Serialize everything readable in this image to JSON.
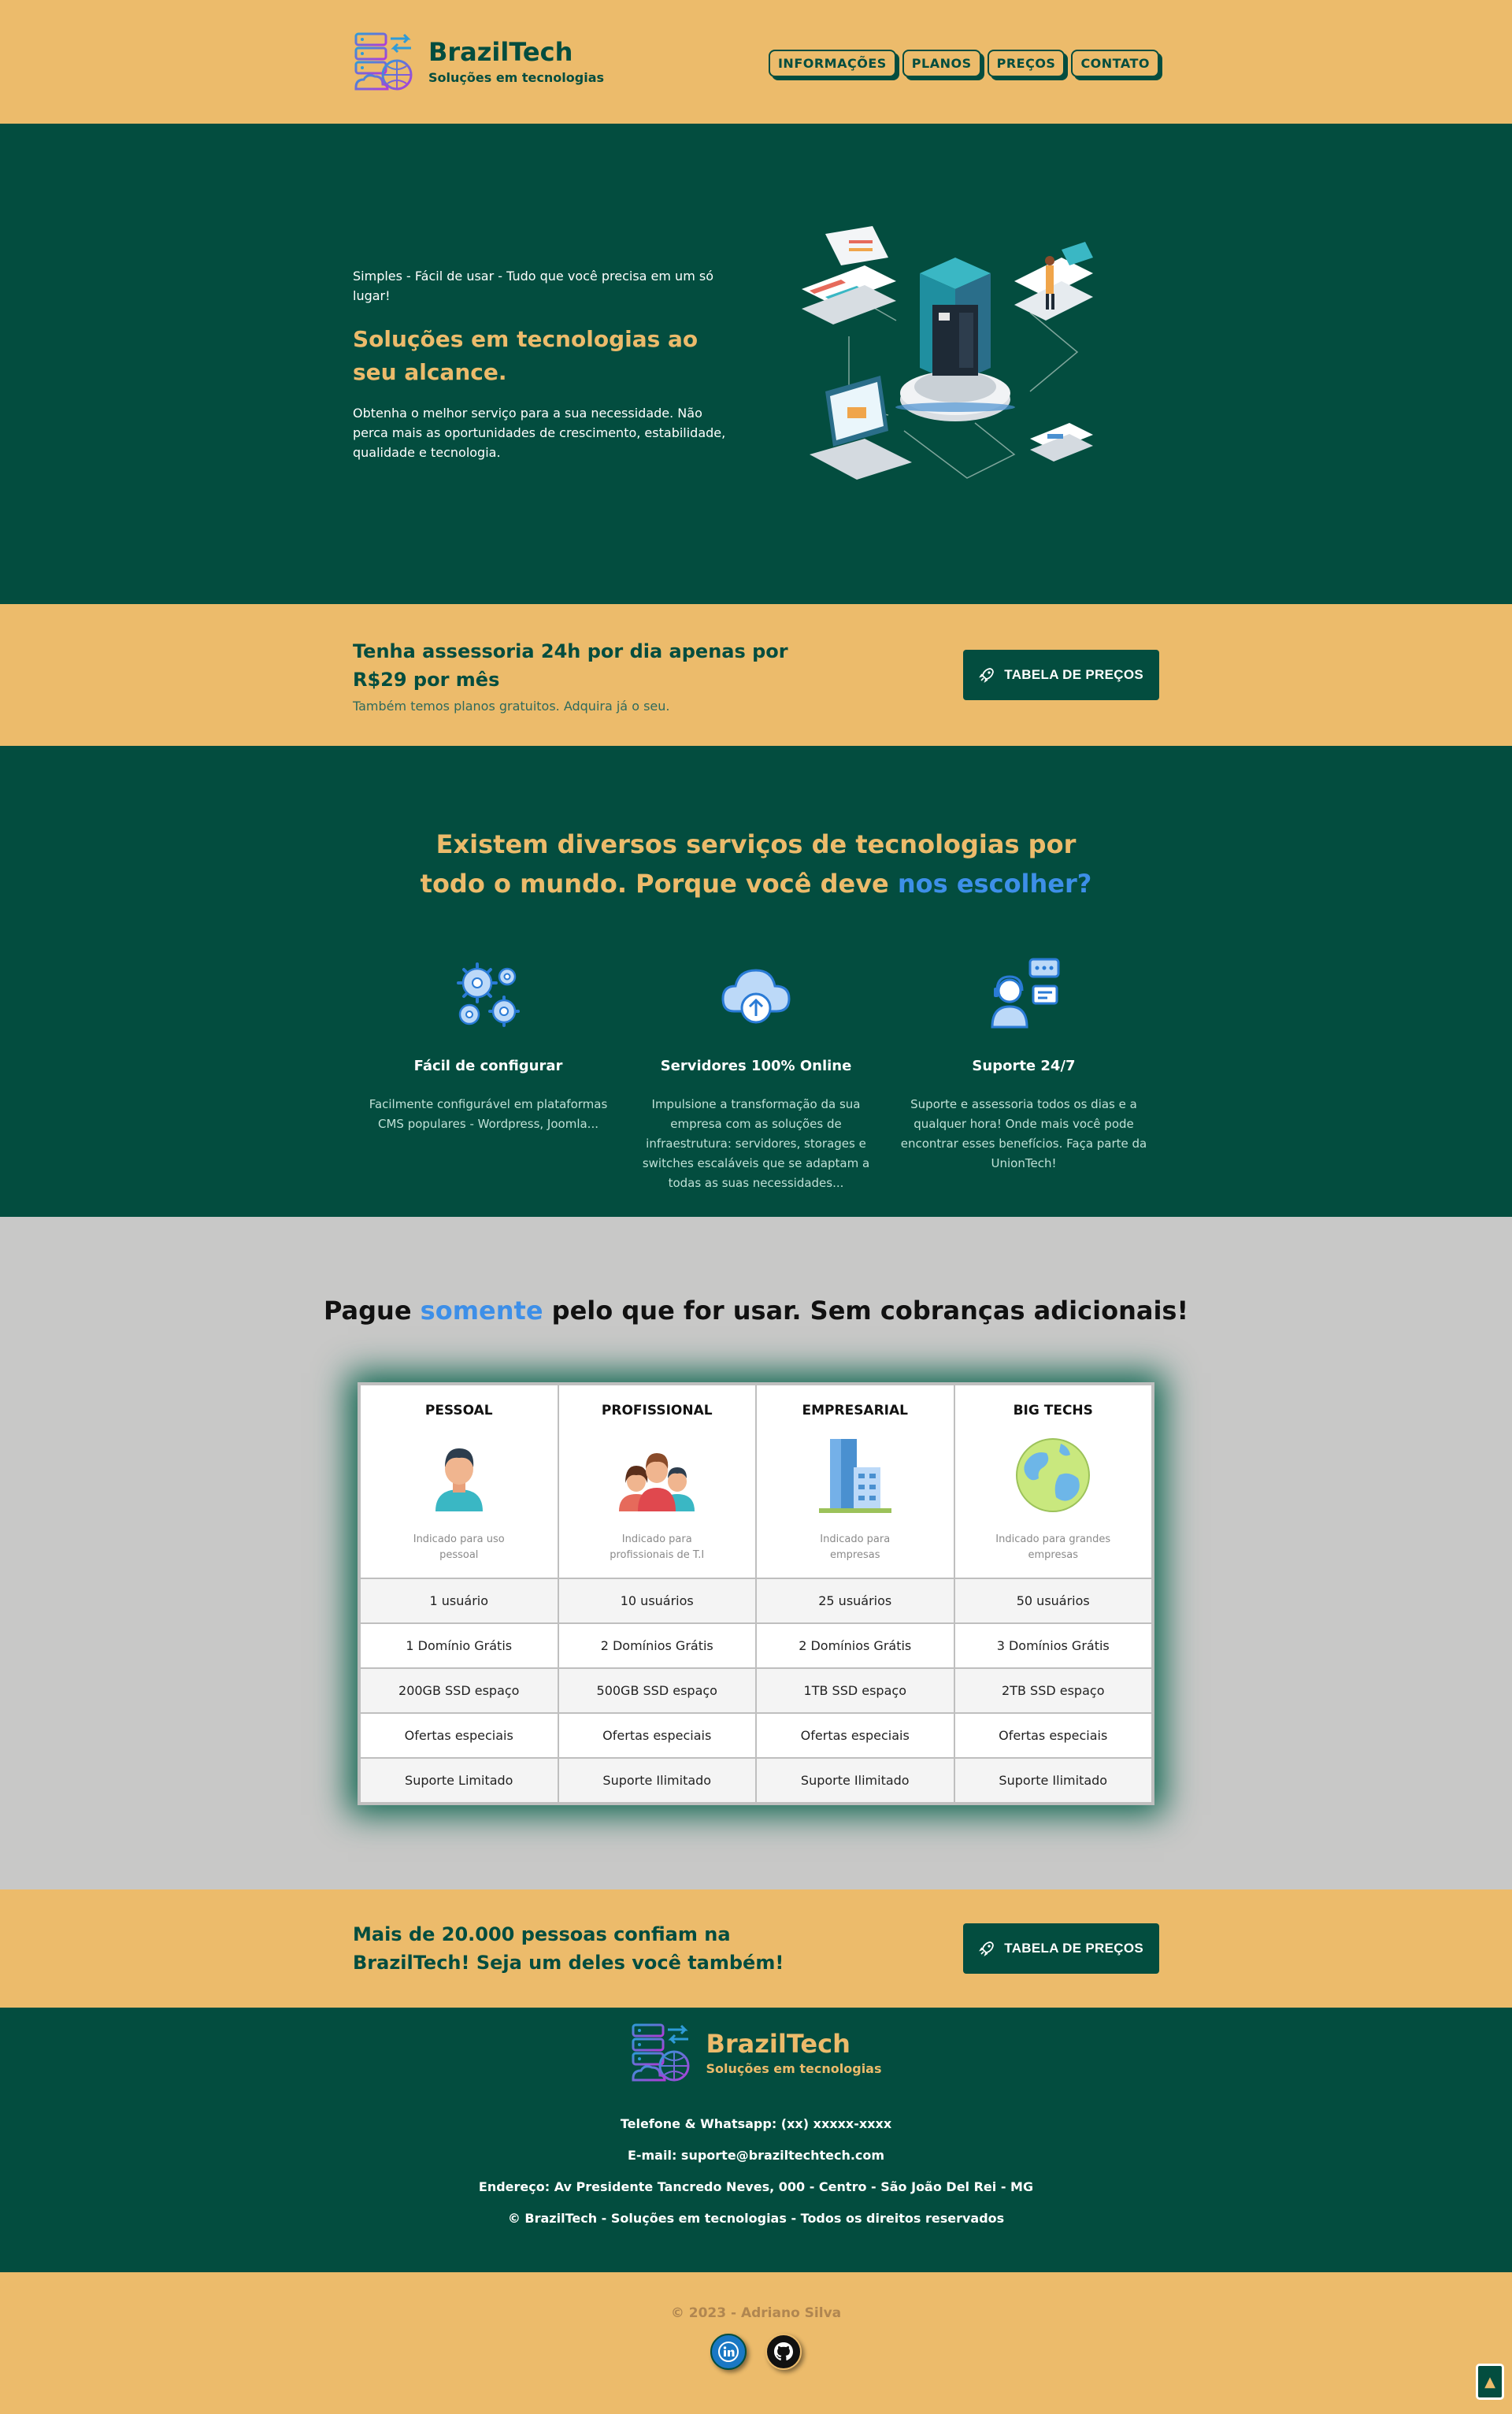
{
  "brand": {
    "name": "BrazilTech",
    "tagline": "Soluções em tecnologias"
  },
  "nav": {
    "items": [
      "INFORMAÇÕES",
      "PLANOS",
      "PREÇOS",
      "CONTATO"
    ]
  },
  "hero": {
    "eyebrow": "Simples - Fácil de usar - Tudo que você precisa em um só lugar!",
    "title": "Soluções em tecnologias ao seu alcance.",
    "description": "Obtenha o melhor serviço para a sua necessidade. Não perca mais as oportunidades de crescimento, estabilidade, qualidade e tecnologia."
  },
  "cta": {
    "title": "Tenha assessoria 24h por dia apenas por R$29 por mês",
    "subtitle": "Também temos planos gratuitos. Adquira já o seu.",
    "button": "TABELA DE PREÇOS"
  },
  "features": {
    "title_start": "Existem diversos serviços de tecnologias por todo o mundo. Porque você deve ",
    "title_highlight": "nos escolher?",
    "items": [
      {
        "icon": "gears-icon",
        "title": "Fácil de configurar",
        "text": "Facilmente configurável em plataformas CMS populares - Wordpress, Joomla..."
      },
      {
        "icon": "cloud-upload-icon",
        "title": "Servidores 100% Online",
        "text": "Impulsione a transformação da sua empresa com as soluções de infraestrutura: servidores, storages e switches escaláveis que se adaptam a todas as suas necessidades..."
      },
      {
        "icon": "support-agent-icon",
        "title": "Suporte 24/7",
        "text": "Suporte e assessoria todos os dias e a qualquer hora! Onde mais você pode encontrar esses benefícios. Faça parte da UnionTech!"
      }
    ]
  },
  "pricing": {
    "title_start": "Pague ",
    "title_highlight": "somente",
    "title_end": " pelo que for usar. Sem cobranças adicionais!",
    "plans": [
      {
        "name": "PESSOAL",
        "icon": "person-icon",
        "desc": "Indicado para uso pessoal"
      },
      {
        "name": "PROFISSIONAL",
        "icon": "team-icon",
        "desc": "Indicado para profissionais de T.I"
      },
      {
        "name": "EMPRESARIAL",
        "icon": "building-icon",
        "desc": "Indicado para empresas"
      },
      {
        "name": "BIG TECHS",
        "icon": "globe-icon",
        "desc": "Indicado para grandes empresas"
      }
    ],
    "rows": [
      [
        "1 usuário",
        "10 usuários",
        "25 usuários",
        "50 usuários"
      ],
      [
        "1 Domínio Grátis",
        "2 Domínios Grátis",
        "2 Domínios Grátis",
        "3 Domínios Grátis"
      ],
      [
        "200GB SSD espaço",
        "500GB SSD espaço",
        "1TB SSD espaço",
        "2TB SSD espaço"
      ],
      [
        "Ofertas especiais",
        "Ofertas especiais",
        "Ofertas especiais",
        "Ofertas especiais"
      ],
      [
        "Suporte Limitado",
        "Suporte Ilimitado",
        "Suporte Ilimitado",
        "Suporte Ilimitado"
      ]
    ]
  },
  "cta2": {
    "title": "Mais de 20.000 pessoas confiam na BrazilTech! Seja um deles você também!",
    "button": "TABELA DE PREÇOS"
  },
  "footer": {
    "phone": "Telefone & Whatsapp: (xx) xxxxx-xxxx",
    "email": "E-mail: suporte@braziltechtech.com",
    "address": "Endereço: Av Presidente Tancredo Neves, 000 - Centro - São João Del Rei - MG",
    "copyright": "© BrazilTech - Soluções em tecnologias - Todos os direitos reservados"
  },
  "credits": {
    "text": "© 2023 - Adriano Silva",
    "social": [
      "linkedin-icon",
      "github-icon"
    ],
    "back_to_top": "▲"
  },
  "colors": {
    "green": "#034d3f",
    "gold": "#ecbb6b",
    "blue": "#3d8fe8",
    "gray": "#c8c8c7"
  }
}
